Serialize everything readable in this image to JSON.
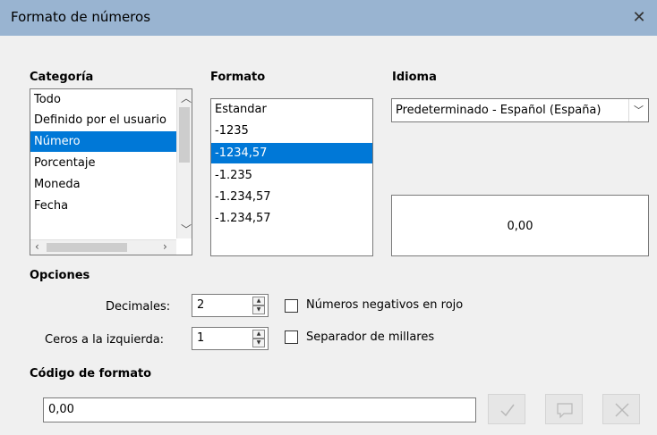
{
  "window": {
    "title": "Formato de números"
  },
  "category": {
    "heading": "Categoría",
    "items": [
      "Todo",
      "Definido por el usuario",
      "Número",
      "Porcentaje",
      "Moneda",
      "Fecha"
    ],
    "selected": "Número"
  },
  "format": {
    "heading": "Formato",
    "items": [
      "Estandar",
      "-1235",
      "-1234,57",
      "-1.235",
      "-1.234,57",
      "-1.234,57"
    ],
    "selected": "-1234,57"
  },
  "language": {
    "heading": "Idioma",
    "value": "Predeterminado - Español (España)"
  },
  "preview": {
    "value": "0,00"
  },
  "options": {
    "heading": "Opciones",
    "decimals_label": "Decimales:",
    "decimals_value": "2",
    "leading_zeros_label": "Ceros a la izquierda:",
    "leading_zeros_value": "1",
    "negative_red_label": "Números negativos en rojo",
    "negative_red_checked": false,
    "thousands_sep_label": "Separador de millares",
    "thousands_sep_checked": false
  },
  "format_code": {
    "heading": "Código de formato",
    "value": "0,00"
  },
  "icons": {
    "close": "close-icon",
    "apply": "checkmark-icon",
    "comment": "comment-icon",
    "delete": "delete-icon"
  },
  "colors": {
    "titlebar": "#99b4d1",
    "selection": "#0078d7"
  }
}
